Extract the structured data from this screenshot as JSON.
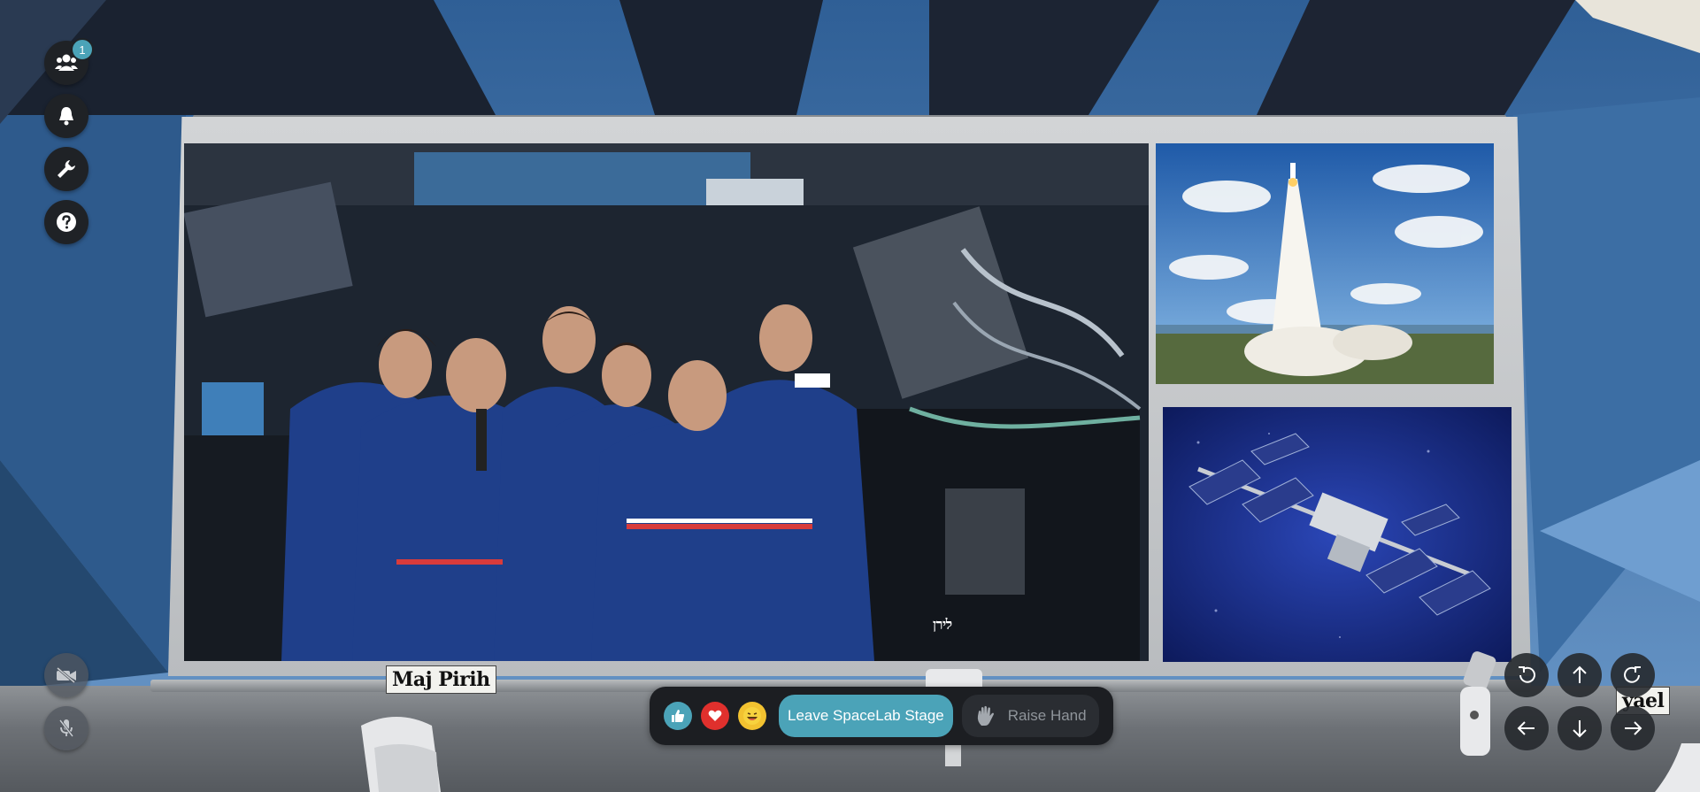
{
  "toolbar": {
    "participants_count": "1",
    "icons": [
      "participants-icon",
      "bell-icon",
      "wrench-icon",
      "help-icon"
    ]
  },
  "media_controls": {
    "icons": [
      "video-off-icon",
      "mic-off-icon"
    ]
  },
  "reactions": {
    "icons": [
      "thumbs-up-icon",
      "heart-icon",
      "laugh-icon"
    ],
    "leave_label": "Leave SpaceLab Stage",
    "raise_hand_label": "Raise Hand"
  },
  "name_tags": {
    "left": "Maj Pirih",
    "right": "yael",
    "stage": "לירן"
  },
  "camera_controls": {
    "icons": [
      "rotate-left-icon",
      "arrow-up-icon",
      "rotate-right-icon",
      "arrow-left-icon",
      "arrow-down-icon",
      "arrow-right-icon"
    ]
  },
  "colors": {
    "accent": "#4ba3b8",
    "panel_dark": "#1c1e22",
    "heart": "#e0302d",
    "laugh": "#f2c230"
  }
}
